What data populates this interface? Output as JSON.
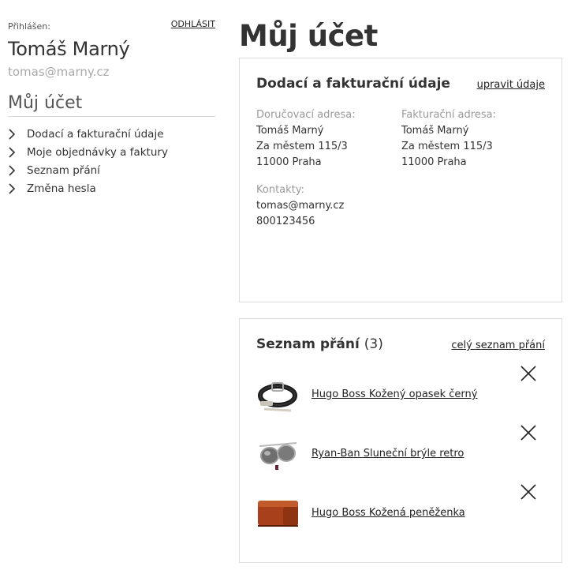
{
  "sidebar": {
    "logged_label": "Přihlášen:",
    "logout_label": "ODHLÁSIT",
    "user_name": "Tomáš Marný",
    "user_email": "tomas@marny.cz",
    "section_title": "Můj účet",
    "nav": [
      {
        "label": "Dodací a fakturační údaje",
        "icon": "chevron-right-icon"
      },
      {
        "label": "Moje objednávky a faktury",
        "icon": "chevron-right-icon"
      },
      {
        "label": "Seznam přání",
        "icon": "chevron-right-icon"
      },
      {
        "label": "Změna hesla",
        "icon": "chevron-right-icon"
      }
    ]
  },
  "main": {
    "title": "Můj účet",
    "billing": {
      "title": "Dodací a fakturační údaje",
      "edit_link": "upravit údaje",
      "delivery": {
        "label": "Doručovací adresa:",
        "name": "Tomáš Marný",
        "street": "Za městem 115/3",
        "city": "11000 Praha"
      },
      "invoice": {
        "label": "Fakturační adresa:",
        "name": "Tomáš Marný",
        "street": "Za městem 115/3",
        "city": "11000 Praha"
      },
      "contacts": {
        "label": "Kontakty:",
        "email": "tomas@marny.cz",
        "phone": "800123456"
      }
    },
    "wishlist": {
      "title": "Seznam přání",
      "count": "(3)",
      "all_link": "celý seznam přání",
      "items": [
        {
          "name": "Hugo Boss Kožený opasek černý",
          "image": "belt-image",
          "remove_icon": "close-icon"
        },
        {
          "name": "Ryan-Ban Sluneční brýle retro",
          "image": "sunglasses-image",
          "remove_icon": "close-icon"
        },
        {
          "name": "Hugo Boss Kožená peněženka",
          "image": "wallet-image",
          "remove_icon": "close-icon"
        }
      ]
    }
  },
  "colors": {
    "text": "#333333",
    "muted": "#999999",
    "border": "#dddddd",
    "email": "#aaaaaa"
  }
}
